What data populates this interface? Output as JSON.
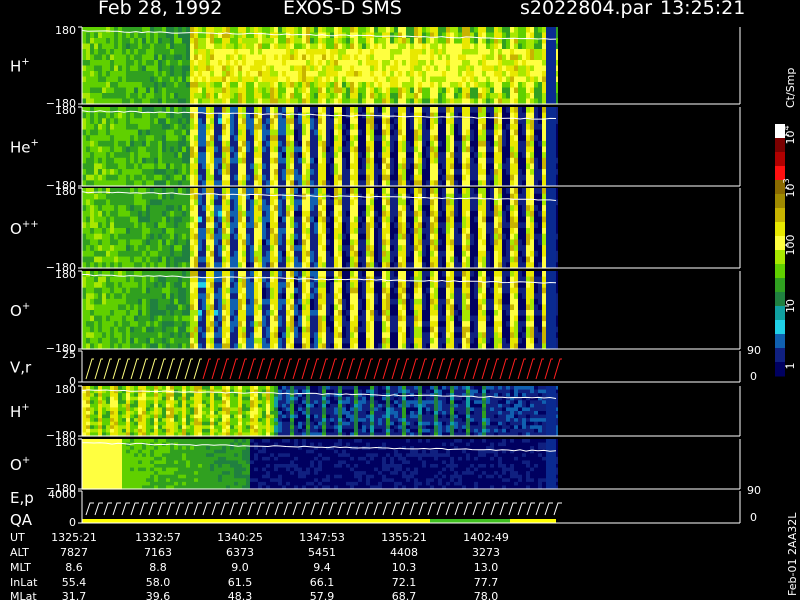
{
  "header": {
    "date": "Feb 28, 1992",
    "instrument": "EXOS-D SMS",
    "file": "s2022804.par",
    "time": "13:25:21"
  },
  "panels": [
    {
      "label": "H",
      "sup": "+",
      "ytop": "180",
      "ybot": "−180"
    },
    {
      "label": "He",
      "sup": "+",
      "ytop": "180",
      "ybot": "−180"
    },
    {
      "label": "O",
      "sup": "++",
      "ytop": "180",
      "ybot": "−180"
    },
    {
      "label": "O",
      "sup": "+",
      "ytop": "180",
      "ybot": "−180"
    },
    {
      "label": "V,r",
      "sup": "",
      "ytop": "25",
      "ybot": "0",
      "rtop": "90",
      "rbot": "0"
    },
    {
      "label": "H",
      "sup": "+",
      "ytop": "180",
      "ybot": "−180"
    },
    {
      "label": "O",
      "sup": "+",
      "ytop": "180",
      "ybot": "−180"
    },
    {
      "label": "E,p",
      "label2": "QA",
      "sup": "",
      "ytop": "4000",
      "ybot": "0",
      "rtop": "90",
      "rbot": "0"
    }
  ],
  "colorbar": {
    "title": "Ct/Smp",
    "ticks": [
      {
        "base": "10",
        "exp": "4"
      },
      {
        "base": "10",
        "exp": "3"
      },
      {
        "base": "100",
        "exp": ""
      },
      {
        "base": "10",
        "exp": ""
      },
      {
        "base": "1",
        "exp": ""
      }
    ],
    "colors": [
      "#ffffff",
      "#7a0000",
      "#b00000",
      "#ff1010",
      "#8a6a00",
      "#a08a00",
      "#c8b400",
      "#e8e800",
      "#ffff40",
      "#a8e800",
      "#60d000",
      "#30a020",
      "#208040",
      "#10a0a0",
      "#20d0e8",
      "#1060b0",
      "#102080",
      "#000060"
    ]
  },
  "footer": {
    "rows": [
      {
        "label": "UT",
        "values": [
          "1325:21",
          "1332:57",
          "1340:25",
          "1347:53",
          "1355:21",
          "1402:49"
        ]
      },
      {
        "label": "ALT",
        "values": [
          "7827",
          "7163",
          "6373",
          "5451",
          "4408",
          "3273"
        ]
      },
      {
        "label": "MLT",
        "values": [
          "8.6",
          "8.8",
          "9.0",
          "9.4",
          "10.3",
          "13.0"
        ]
      },
      {
        "label": "InLat",
        "values": [
          "55.4",
          "58.0",
          "61.5",
          "66.1",
          "72.1",
          "77.7"
        ]
      },
      {
        "label": "MLat",
        "values": [
          "31.7",
          "39.6",
          "48.3",
          "57.9",
          "68.7",
          "78.0"
        ]
      }
    ],
    "stamp": "Feb-01 2AA32L"
  },
  "chart_data": {
    "type": "heatmap",
    "title": "Feb 28, 1992   EXOS-D SMS",
    "subtitle": "s2022804.par  13:25:21",
    "x_ticks": [
      "1325:21",
      "1332:57",
      "1340:25",
      "1347:53",
      "1355:21",
      "1402:49"
    ],
    "series": [
      {
        "name": "H+",
        "y_range": [
          -180,
          180
        ]
      },
      {
        "name": "He+",
        "y_range": [
          -180,
          180
        ]
      },
      {
        "name": "O++",
        "y_range": [
          -180,
          180
        ]
      },
      {
        "name": "O+",
        "y_range": [
          -180,
          180
        ]
      },
      {
        "name": "V,r",
        "y_range": [
          0,
          25
        ],
        "right_range": [
          0,
          90
        ]
      },
      {
        "name": "H+",
        "y_range": [
          -180,
          180
        ]
      },
      {
        "name": "O+",
        "y_range": [
          -180,
          180
        ]
      },
      {
        "name": "E,p",
        "y_range": [
          0,
          4000
        ],
        "right_range": [
          0,
          90
        ]
      }
    ],
    "colorbar_scale": "log",
    "colorbar_range": [
      1,
      10000
    ],
    "colorbar_unit": "Ct/Smp"
  }
}
